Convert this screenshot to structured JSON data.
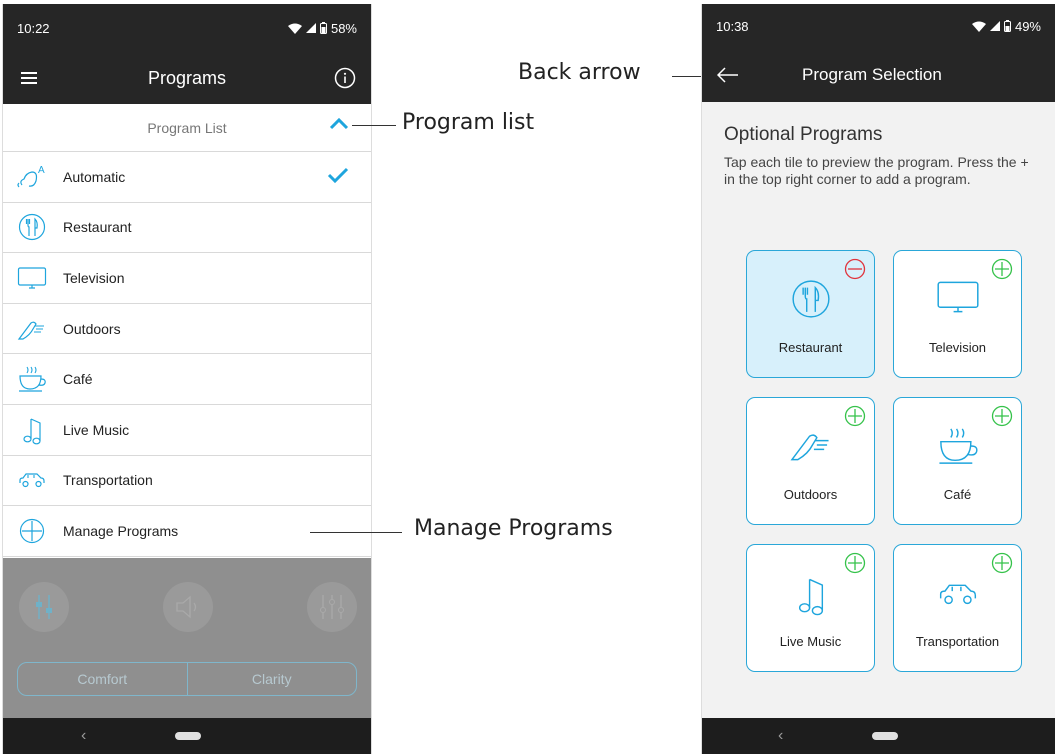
{
  "left_phone": {
    "status": {
      "time": "10:22",
      "battery": "58%"
    },
    "appbar": {
      "title": "Programs",
      "menu_icon": "menu-icon",
      "info_icon": "info-icon"
    },
    "list_header": {
      "label": "Program List",
      "toggle_icon": "chevron-up-icon"
    },
    "programs": [
      {
        "label": "Automatic",
        "icon": "automatic-ear-icon",
        "selected": true
      },
      {
        "label": "Restaurant",
        "icon": "fork-knife-icon",
        "selected": false
      },
      {
        "label": "Television",
        "icon": "tv-icon",
        "selected": false
      },
      {
        "label": "Outdoors",
        "icon": "shoe-icon",
        "selected": false
      },
      {
        "label": "Café",
        "icon": "coffee-cup-icon",
        "selected": false
      },
      {
        "label": "Live Music",
        "icon": "music-note-icon",
        "selected": false
      },
      {
        "label": "Transportation",
        "icon": "car-icon",
        "selected": false
      },
      {
        "label": "Manage Programs",
        "icon": "plus-circle-icon",
        "selected": false
      }
    ],
    "bottom_controls": {
      "segments": [
        "Comfort",
        "Clarity"
      ]
    },
    "navbar": {
      "back_glyph": "‹"
    }
  },
  "callouts": {
    "program_list": "Program list",
    "manage_programs": "Manage Programs",
    "back_arrow": "Back arrow"
  },
  "right_phone": {
    "status": {
      "time": "10:38",
      "battery": "49%"
    },
    "appbar": {
      "title": "Program Selection",
      "back_icon": "back-arrow-icon"
    },
    "heading": "Optional Programs",
    "description": "Tap each tile to preview the program. Press the + in the top right corner to add a program.",
    "tiles": [
      {
        "label": "Restaurant",
        "icon": "fork-knife-icon",
        "badge": "remove",
        "selected": true
      },
      {
        "label": "Television",
        "icon": "tv-icon",
        "badge": "add",
        "selected": false
      },
      {
        "label": "Outdoors",
        "icon": "shoe-icon",
        "badge": "add",
        "selected": false
      },
      {
        "label": "Café",
        "icon": "coffee-cup-icon",
        "badge": "add",
        "selected": false
      },
      {
        "label": "Live Music",
        "icon": "music-note-icon",
        "badge": "add",
        "selected": false
      },
      {
        "label": "Transportation",
        "icon": "car-icon",
        "badge": "add",
        "selected": false
      }
    ],
    "navbar": {
      "back_glyph": "‹"
    }
  },
  "colors": {
    "accent": "#1ea5dd",
    "add_badge": "#35c24a",
    "remove_badge": "#e0333c",
    "bar": "#262626"
  }
}
